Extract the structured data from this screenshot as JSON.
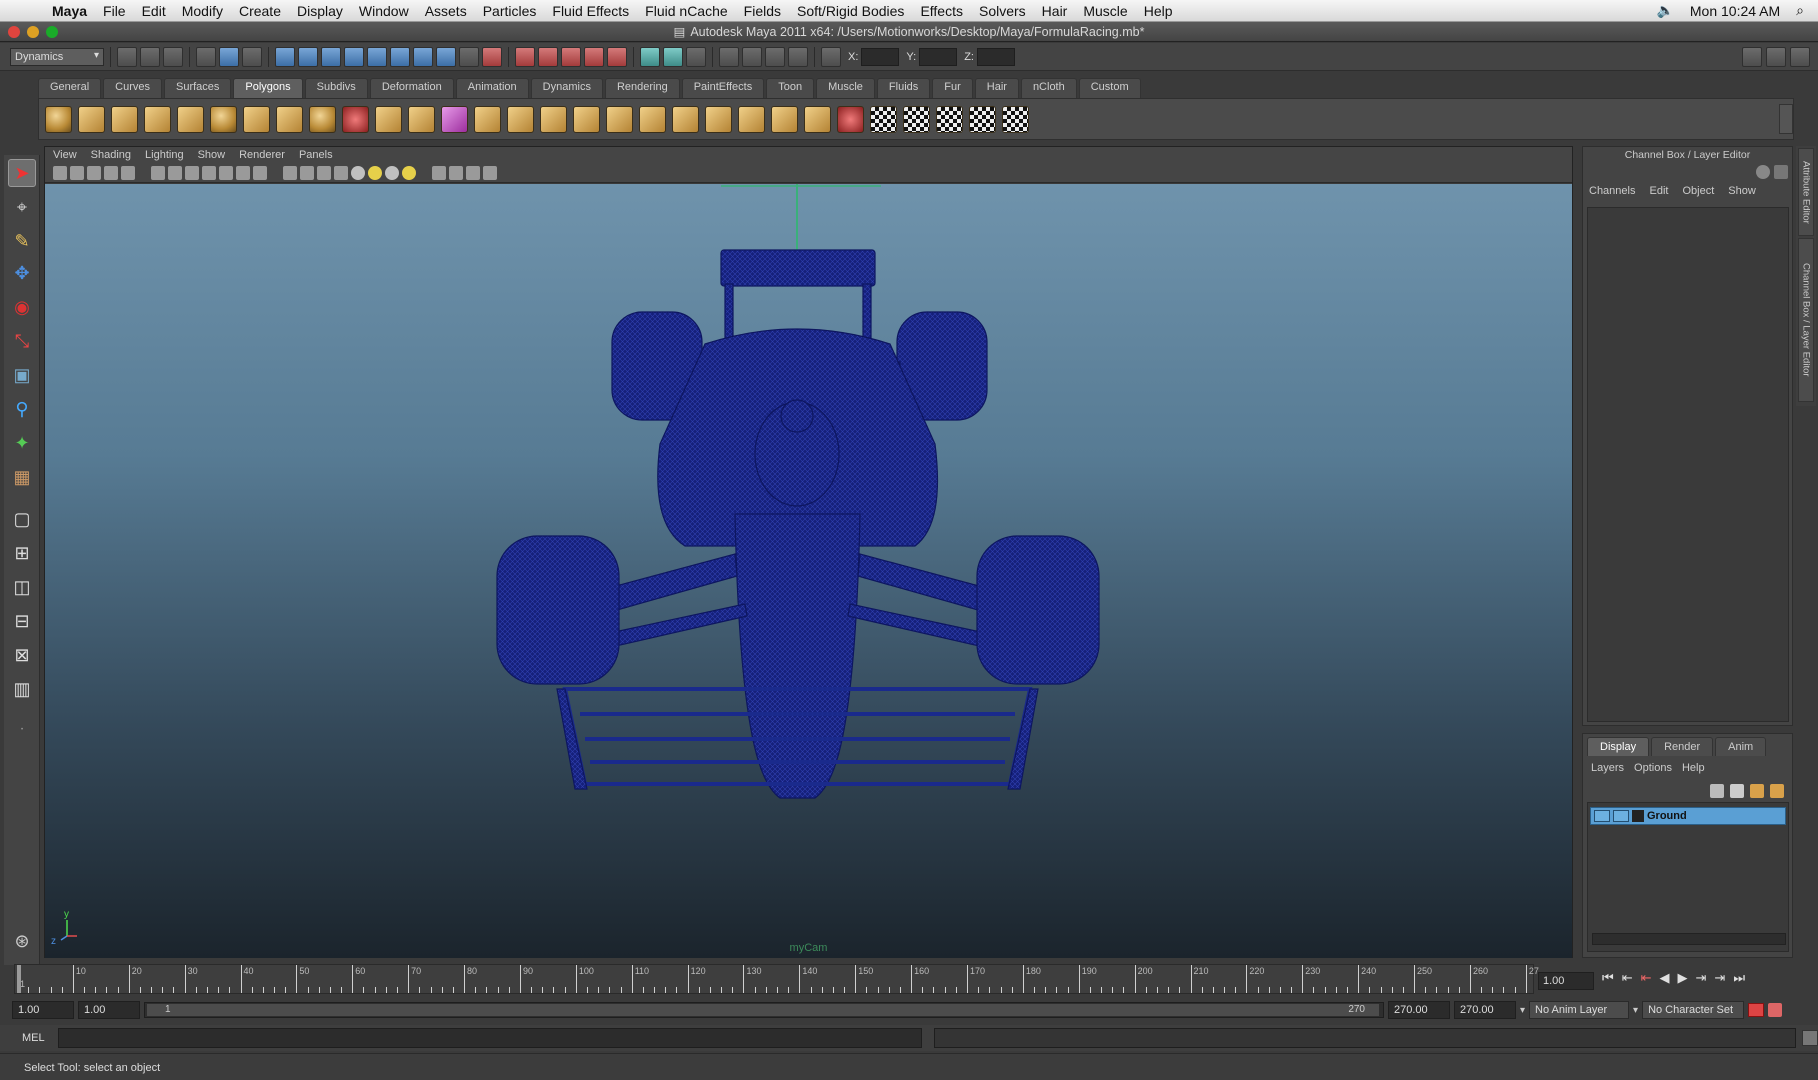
{
  "os_menubar": {
    "items": [
      "Maya",
      "File",
      "Edit",
      "Modify",
      "Create",
      "Display",
      "Window",
      "Assets",
      "Particles",
      "Fluid Effects",
      "Fluid nCache",
      "Fields",
      "Soft/Rigid Bodies",
      "Effects",
      "Solvers",
      "Hair",
      "Muscle",
      "Help"
    ],
    "clock": "Mon 10:24 AM"
  },
  "window": {
    "title": "Autodesk Maya 2011 x64: /Users/Motionworks/Desktop/Maya/FormulaRacing.mb*"
  },
  "status_line": {
    "menu_set": "Dynamics",
    "x_label": "X:",
    "y_label": "Y:",
    "z_label": "Z:"
  },
  "shelf": {
    "tabs": [
      "General",
      "Curves",
      "Surfaces",
      "Polygons",
      "Subdivs",
      "Deformation",
      "Animation",
      "Dynamics",
      "Rendering",
      "PaintEffects",
      "Toon",
      "Muscle",
      "Fluids",
      "Fur",
      "Hair",
      "nCloth",
      "Custom"
    ],
    "active_tab": "Polygons"
  },
  "viewport": {
    "menus": [
      "View",
      "Shading",
      "Lighting",
      "Show",
      "Renderer",
      "Panels"
    ],
    "camera_name": "myCam",
    "wire_color": "#1a2a8c",
    "axis_y": "y",
    "axis_z": "z"
  },
  "channel_box": {
    "title": "Channel Box / Layer Editor",
    "menus": [
      "Channels",
      "Edit",
      "Object",
      "Show"
    ]
  },
  "side_tabs": {
    "attribute_editor": "Attribute Editor",
    "channel_box": "Channel Box / Layer Editor"
  },
  "layer_editor": {
    "tabs": [
      "Display",
      "Render",
      "Anim"
    ],
    "active_tab": "Display",
    "menus": [
      "Layers",
      "Options",
      "Help"
    ],
    "layers": [
      {
        "name": "Ground",
        "color": "#5a9fd4"
      }
    ]
  },
  "time_slider": {
    "ticks": [
      10,
      20,
      30,
      40,
      50,
      60,
      70,
      80,
      90,
      100,
      110,
      120,
      130,
      140,
      150,
      160,
      170,
      180,
      190,
      200,
      210,
      220,
      230,
      240,
      250,
      260,
      27
    ],
    "start_label": "1",
    "current_frame": "1.00"
  },
  "range_slider": {
    "start": "1.00",
    "playback_start": "1.00",
    "bar_left": "1",
    "bar_right": "270",
    "playback_end": "270.00",
    "end": "270.00",
    "anim_layer": "No Anim Layer",
    "character_set": "No Character Set"
  },
  "command_line": {
    "label": "MEL"
  },
  "help_line": {
    "text": "Select Tool: select an object"
  }
}
